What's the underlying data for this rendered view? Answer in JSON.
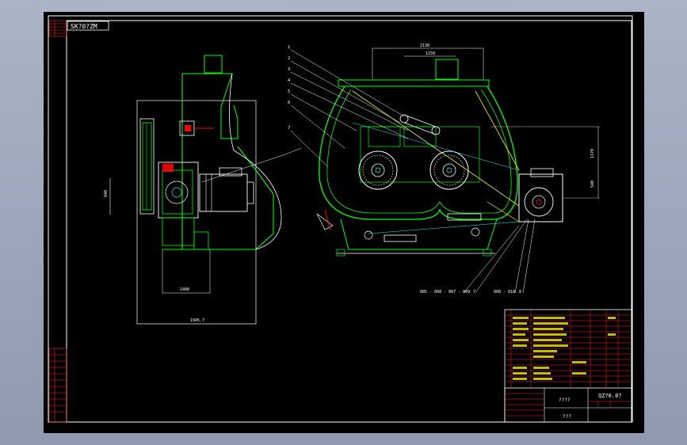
{
  "drawing": {
    "code_tag": "SK?0?ZM",
    "title_block": {
      "name": "????",
      "drawing_no": "QZ?0.0?",
      "company": "???"
    },
    "dimensions": {
      "top_overall": "2130",
      "top_inner": "1150",
      "left_height": "840",
      "bottom_left": "1400",
      "bottom_overall": "1945.7",
      "right_upper": "1170",
      "right_lower": "540"
    },
    "side_callouts": [
      "1",
      "2",
      "3",
      "4",
      "5",
      "6",
      "7"
    ],
    "bottom_callouts": [
      "005 - 008 - 007 - 009",
      "7",
      "008 - 018",
      "8"
    ],
    "colors": {
      "outline": "#ffffff",
      "machine": "#00ff00",
      "leader": "#ffff00",
      "dimension": "#00ffff",
      "highlight": "#ff0000"
    }
  }
}
